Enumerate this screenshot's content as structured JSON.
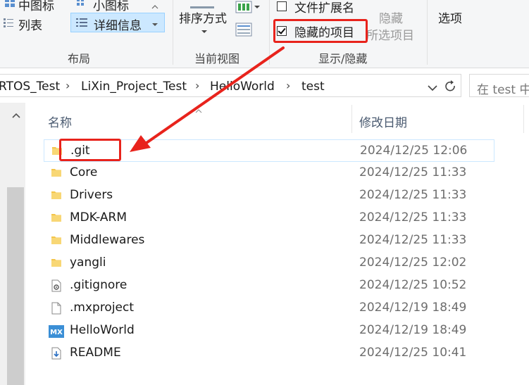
{
  "ribbon": {
    "layout": {
      "medium_icons": "中图标",
      "small_icons": "小图标",
      "list": "列表",
      "details": "详细信息",
      "group_label": "布局"
    },
    "current_view": {
      "sort_by": "排序方式",
      "group_label": "当前视图"
    },
    "show_hide": {
      "file_extensions": "文件扩展名",
      "hidden_items": "隐藏的项目",
      "hide": "隐藏",
      "selected_items": "所选项目",
      "group_label": "显示/隐藏"
    },
    "options": "选项"
  },
  "address": {
    "crumbs": [
      "RTOS_Test",
      "LiXin_Project_Test",
      "HelloWorld",
      "test"
    ],
    "search_placeholder": "在 test 中"
  },
  "list": {
    "headers": {
      "name": "名称",
      "modified": "修改日期"
    },
    "files": [
      {
        "name": ".git",
        "date": "2024/12/25 12:06",
        "type": "folder"
      },
      {
        "name": "Core",
        "date": "2024/12/25 11:33",
        "type": "folder"
      },
      {
        "name": "Drivers",
        "date": "2024/12/25 11:33",
        "type": "folder"
      },
      {
        "name": "MDK-ARM",
        "date": "2024/12/25 11:33",
        "type": "folder"
      },
      {
        "name": "Middlewares",
        "date": "2024/12/25 11:33",
        "type": "folder"
      },
      {
        "name": "yangli",
        "date": "2024/12/25 12:02",
        "type": "folder"
      },
      {
        "name": ".gitignore",
        "date": "2024/12/25 10:52",
        "type": "config"
      },
      {
        "name": ".mxproject",
        "date": "2024/12/19 18:49",
        "type": "file"
      },
      {
        "name": "HelloWorld",
        "date": "2024/12/19 18:49",
        "type": "mx"
      },
      {
        "name": "README",
        "date": "2024/12/25 10:41",
        "type": "readme"
      }
    ]
  },
  "colors": {
    "annotation": "#e8231c",
    "folder": "#f4c54a",
    "selection": "#cce8ff"
  }
}
